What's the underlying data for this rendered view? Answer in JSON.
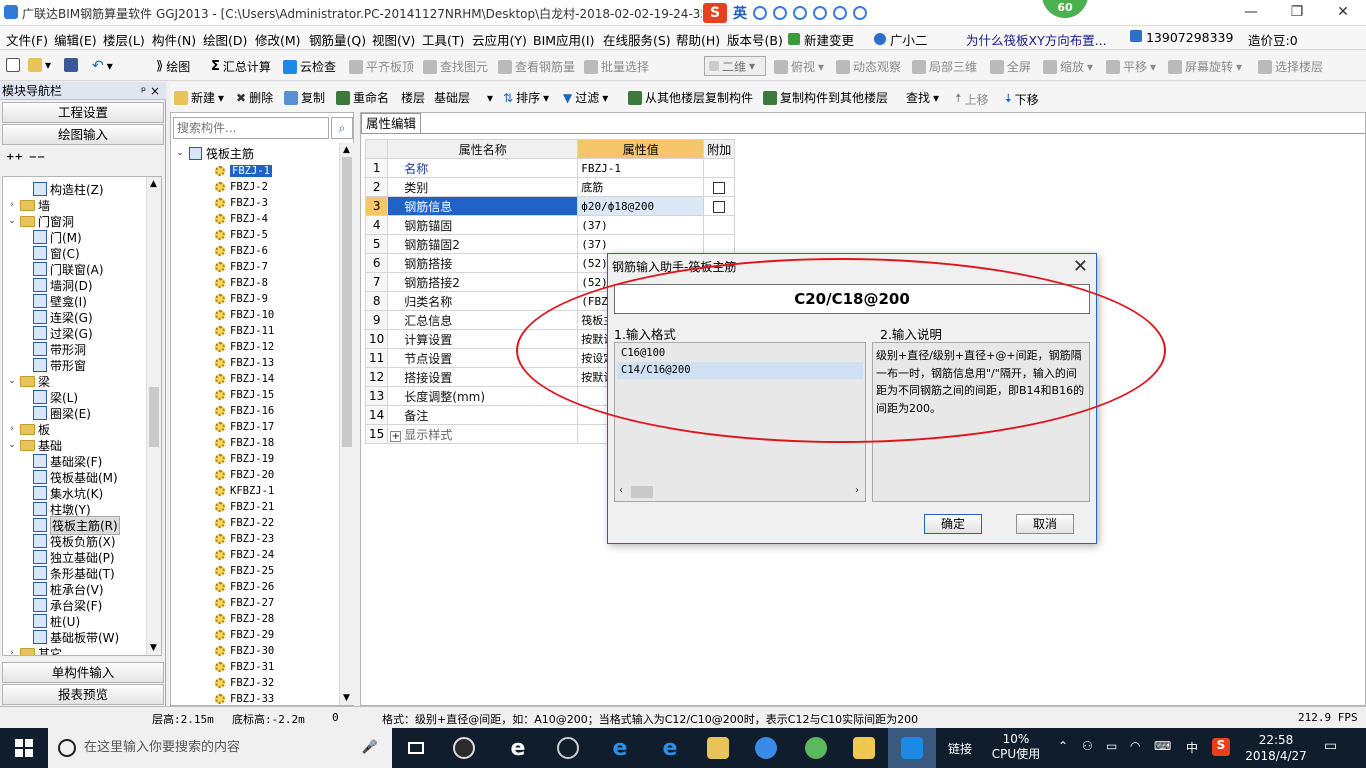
{
  "window": {
    "title": "广联达BIM钢筋算量软件 GGJ2013 - [C:\\Users\\Administrator.PC-20141127NRHM\\Desktop\\白龙村-2018-02-02-19-24-35",
    "ime_label": "英",
    "badge": "60",
    "minimize": "—",
    "restore": "❐",
    "close": "✕"
  },
  "menu": [
    "文件(F)",
    "编辑(E)",
    "楼层(L)",
    "构件(N)",
    "绘图(D)",
    "修改(M)",
    "钢筋量(Q)",
    "视图(V)",
    "工具(T)",
    "云应用(Y)",
    "BIM应用(I)",
    "在线服务(S)",
    "帮助(H)",
    "版本号(B)",
    "新建变更",
    "广小二",
    "为什么筏板XY方向布置...",
    "13907298339",
    "造价豆:0"
  ],
  "toolbar1": {
    "draw": "绘图",
    "sum": "汇总计算",
    "cloud_check": "云检查",
    "level_top": "平齐板顶",
    "find_element": "查找图元",
    "view_rebar": "查看钢筋量",
    "batch_select": "批量选择",
    "view_mode": "二维",
    "top_view": "俯视",
    "dynamic": "动态观察",
    "local3d": "局部三维",
    "fullscreen": "全屏",
    "zoom": "缩放",
    "pan": "平移",
    "rotate": "屏幕旋转",
    "select_floor": "选择楼层"
  },
  "toolbar2": {
    "new": "新建",
    "delete": "删除",
    "copy": "复制",
    "rename": "重命名",
    "floor": "楼层",
    "floor_value": "基础层",
    "sort": "排序",
    "filter": "过滤",
    "copy_from": "从其他楼层复制构件",
    "copy_to": "复制构件到其他楼层",
    "find": "查找",
    "up": "上移",
    "down": "下移"
  },
  "left": {
    "header": "模块导航栏",
    "pin": "ᵖ ×",
    "project": "工程设置",
    "draw_input": "绘图输入",
    "single_input": "单构件输入",
    "report": "报表预览",
    "tree": [
      {
        "label": "构造柱(Z)",
        "type": "item",
        "level": 2
      },
      {
        "label": "墙",
        "type": "folder",
        "level": 1,
        "exp": "›"
      },
      {
        "label": "门窗洞",
        "type": "folder",
        "level": 1,
        "exp": "⌄"
      },
      {
        "label": "门(M)",
        "type": "item",
        "level": 2
      },
      {
        "label": "窗(C)",
        "type": "item",
        "level": 2
      },
      {
        "label": "门联窗(A)",
        "type": "item",
        "level": 2
      },
      {
        "label": "墙洞(D)",
        "type": "item",
        "level": 2
      },
      {
        "label": "壁龛(I)",
        "type": "item",
        "level": 2
      },
      {
        "label": "连梁(G)",
        "type": "item",
        "level": 2
      },
      {
        "label": "过梁(G)",
        "type": "item",
        "level": 2
      },
      {
        "label": "带形洞",
        "type": "item",
        "level": 2
      },
      {
        "label": "带形窗",
        "type": "item",
        "level": 2
      },
      {
        "label": "梁",
        "type": "folder",
        "level": 1,
        "exp": "⌄"
      },
      {
        "label": "梁(L)",
        "type": "item",
        "level": 2
      },
      {
        "label": "圈梁(E)",
        "type": "item",
        "level": 2
      },
      {
        "label": "板",
        "type": "folder",
        "level": 1,
        "exp": "›"
      },
      {
        "label": "基础",
        "type": "folder",
        "level": 1,
        "exp": "⌄"
      },
      {
        "label": "基础梁(F)",
        "type": "item",
        "level": 2
      },
      {
        "label": "筏板基础(M)",
        "type": "item",
        "level": 2
      },
      {
        "label": "集水坑(K)",
        "type": "item",
        "level": 2
      },
      {
        "label": "柱墩(Y)",
        "type": "item",
        "level": 2
      },
      {
        "label": "筏板主筋(R)",
        "type": "item",
        "level": 2,
        "selected": true
      },
      {
        "label": "筏板负筋(X)",
        "type": "item",
        "level": 2
      },
      {
        "label": "独立基础(P)",
        "type": "item",
        "level": 2
      },
      {
        "label": "条形基础(T)",
        "type": "item",
        "level": 2
      },
      {
        "label": "桩承台(V)",
        "type": "item",
        "level": 2
      },
      {
        "label": "承台梁(F)",
        "type": "item",
        "level": 2
      },
      {
        "label": "桩(U)",
        "type": "item",
        "level": 2
      },
      {
        "label": "基础板带(W)",
        "type": "item",
        "level": 2
      },
      {
        "label": "其它",
        "type": "folder",
        "level": 1,
        "exp": "›"
      }
    ]
  },
  "middle": {
    "search_placeholder": "搜索构件...",
    "root": "筏板主筋",
    "items": [
      "FBZJ-1",
      "FBZJ-2",
      "FBZJ-3",
      "FBZJ-4",
      "FBZJ-5",
      "FBZJ-6",
      "FBZJ-7",
      "FBZJ-8",
      "FBZJ-9",
      "FBZJ-10",
      "FBZJ-11",
      "FBZJ-12",
      "FBZJ-13",
      "FBZJ-14",
      "FBZJ-15",
      "FBZJ-16",
      "FBZJ-17",
      "FBZJ-18",
      "FBZJ-19",
      "FBZJ-20",
      "KFBZJ-1",
      "FBZJ-21",
      "FBZJ-22",
      "FBZJ-23",
      "FBZJ-24",
      "FBZJ-25",
      "FBZJ-26",
      "FBZJ-27",
      "FBZJ-28",
      "FBZJ-29",
      "FBZJ-30",
      "FBZJ-31",
      "FBZJ-32",
      "FBZJ-33"
    ]
  },
  "props": {
    "tab": "属性编辑",
    "headers": [
      "属性名称",
      "属性值",
      "附加"
    ],
    "rows": [
      {
        "n": "1",
        "name": "名称",
        "value": "FBZJ-1",
        "check": false,
        "blue": true
      },
      {
        "n": "2",
        "name": "类别",
        "value": "底筋",
        "check": true
      },
      {
        "n": "3",
        "name": "钢筋信息",
        "value": "ф20/ф18@200",
        "check": true,
        "selected": true
      },
      {
        "n": "4",
        "name": "钢筋锚固",
        "value": "(37)",
        "check": false
      },
      {
        "n": "5",
        "name": "钢筋锚固2",
        "value": "(37)",
        "check": false
      },
      {
        "n": "6",
        "name": "钢筋搭接",
        "value": "(52)",
        "check": false
      },
      {
        "n": "7",
        "name": "钢筋搭接2",
        "value": "(52)",
        "check": false
      },
      {
        "n": "8",
        "name": "归类名称",
        "value": "(FBZ",
        "check": false
      },
      {
        "n": "9",
        "name": "汇总信息",
        "value": "筏板主",
        "check": false
      },
      {
        "n": "10",
        "name": "计算设置",
        "value": "按默认",
        "check": false
      },
      {
        "n": "11",
        "name": "节点设置",
        "value": "按设定",
        "check": false
      },
      {
        "n": "12",
        "name": "搭接设置",
        "value": "按默认",
        "check": false
      },
      {
        "n": "13",
        "name": "长度调整(mm)",
        "value": "",
        "check": false
      },
      {
        "n": "14",
        "name": "备注",
        "value": "",
        "check": false
      },
      {
        "n": "15",
        "name": "显示样式",
        "value": "",
        "check": false,
        "expander": true
      }
    ]
  },
  "dialog": {
    "title": "钢筋输入助手-筏板主筋",
    "formula": "C20/C18@200",
    "format_label": "1.输入格式",
    "explain_label": "2.输入说明",
    "formats": [
      "C16@100",
      "C14/C16@200"
    ],
    "explanation": "级别+直径/级别+直径+@+间距，钢筋隔一布一时，钢筋信息用\"/\"隔开，输入的间距为不同钢筋之间的间距，即B14和B16的间距为200。",
    "ok": "确定",
    "cancel": "取消"
  },
  "status": {
    "floor_height": "层高:2.15m",
    "base_height": "底标高:-2.2m",
    "zero": "0",
    "hint": "格式：级别+直径@间距，如：A10@200；当格式输入为C12/C10@200时，表示C12与C10实际间距为200",
    "fps": "212.9 FPS"
  },
  "taskbar": {
    "search_placeholder": "在这里输入你要搜索的内容",
    "link": "链接",
    "cpu_value": "10%",
    "cpu_label": "CPU使用",
    "lang": "中",
    "time": "22:58",
    "date": "2018/4/27"
  },
  "colors": {
    "accent": "#1e64c8",
    "ellipse": "#e0141e",
    "prop_value_header": "#f5c76a"
  }
}
